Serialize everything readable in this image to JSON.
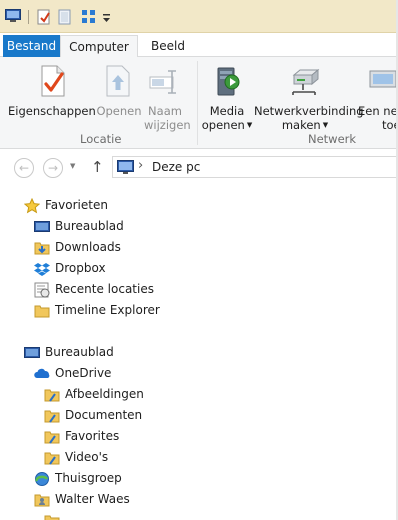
{
  "quick_access": {
    "icons": [
      "app-window-icon",
      "properties-icon",
      "new-folder-icon",
      "view-icon",
      "customize-dropdown-icon"
    ]
  },
  "ribbon_tabs": {
    "file": "Bestand",
    "computer": "Computer",
    "view": "Beeld"
  },
  "ribbon": {
    "location_group": {
      "label": "Locatie",
      "properties": "Eigenschappen",
      "open": "Openen",
      "rename_line1": "Naam",
      "rename_line2": "wijzigen"
    },
    "network_group": {
      "label": "Netwerk",
      "media_line1": "Media",
      "media_line2": "openen",
      "map_drive_line1": "Netwerkverbinding",
      "map_drive_line2": "maken",
      "add_location_line1": "Een net",
      "add_location_line2": "toe"
    }
  },
  "address": {
    "back_glyph": "←",
    "forward_glyph": "→",
    "up_glyph": "↑",
    "separator_glyph": "›",
    "path": "Deze pc"
  },
  "nav": {
    "favorites": {
      "label": "Favorieten",
      "items": [
        "Bureaublad",
        "Downloads",
        "Dropbox",
        "Recente locaties",
        "Timeline Explorer"
      ]
    },
    "desktop": {
      "label": "Bureaublad",
      "onedrive": "OneDrive",
      "onedrive_items": [
        "Afbeeldingen",
        "Documenten",
        "Favorites",
        "Video's"
      ],
      "homegroup": "Thuisgroep",
      "user": "Walter Waes"
    }
  },
  "colors": {
    "file_tab": "#1979ca",
    "title_bar": "#f2e8c8",
    "ribbon_bg": "#f5f6f7"
  }
}
